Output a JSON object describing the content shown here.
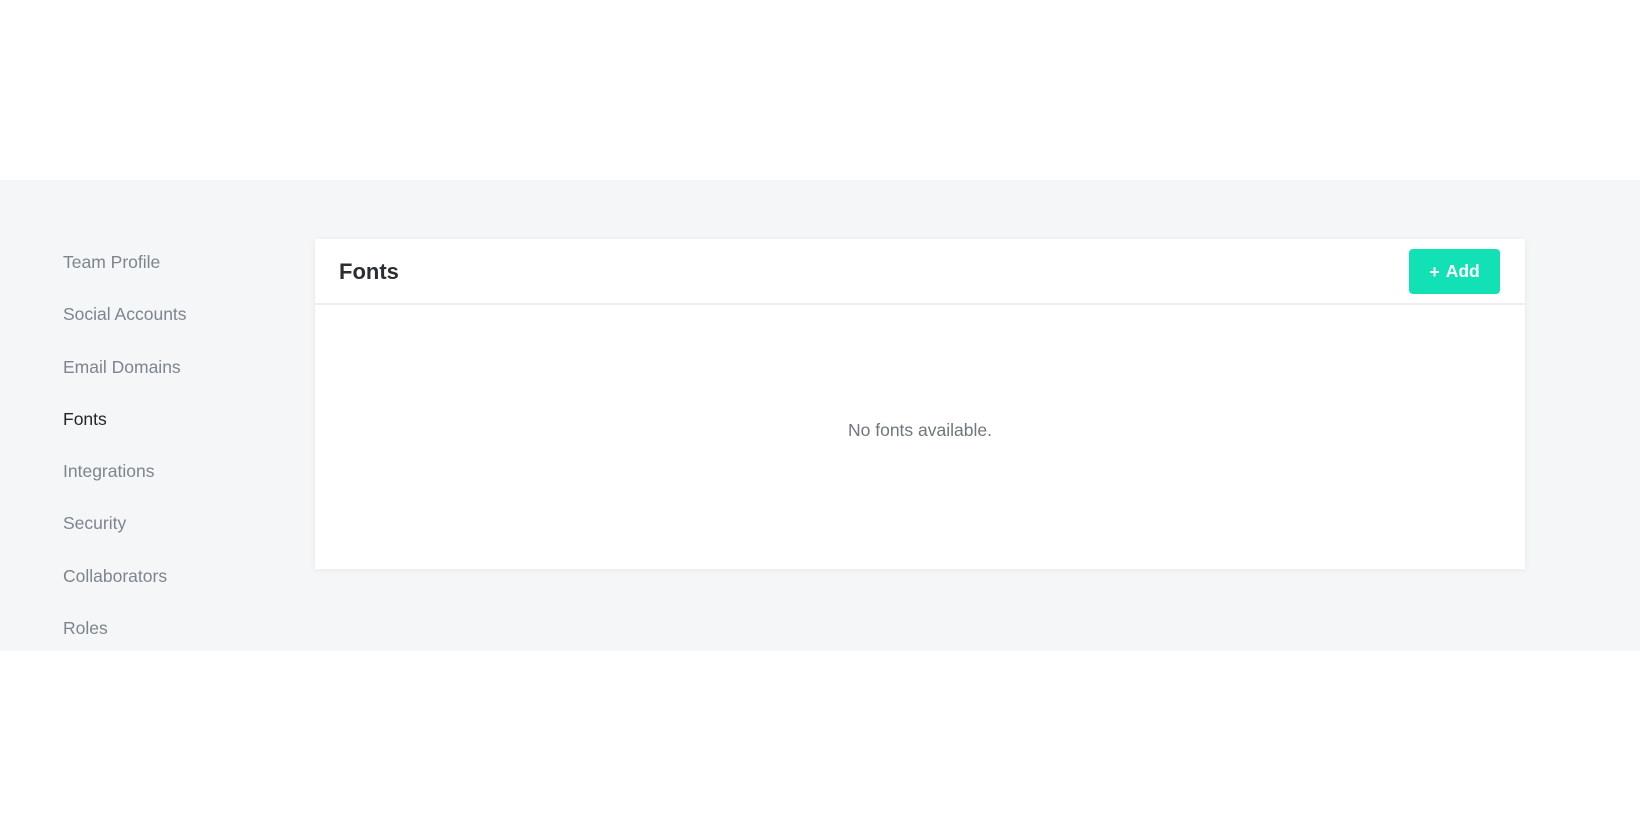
{
  "sidebar": {
    "items": [
      {
        "label": "Team Profile",
        "active": false
      },
      {
        "label": "Social Accounts",
        "active": false
      },
      {
        "label": "Email Domains",
        "active": false
      },
      {
        "label": "Fonts",
        "active": true
      },
      {
        "label": "Integrations",
        "active": false
      },
      {
        "label": "Security",
        "active": false
      },
      {
        "label": "Collaborators",
        "active": false
      },
      {
        "label": "Roles",
        "active": false
      }
    ]
  },
  "main": {
    "title": "Fonts",
    "add_button": {
      "icon": "+",
      "icon_name": "plus-icon",
      "label": "Add"
    },
    "empty_message": "No fonts available."
  },
  "colors": {
    "accent": "#12e0b5",
    "band_background": "#f5f6f7",
    "active_text": "#23272b",
    "muted_text": "#7d858d"
  }
}
